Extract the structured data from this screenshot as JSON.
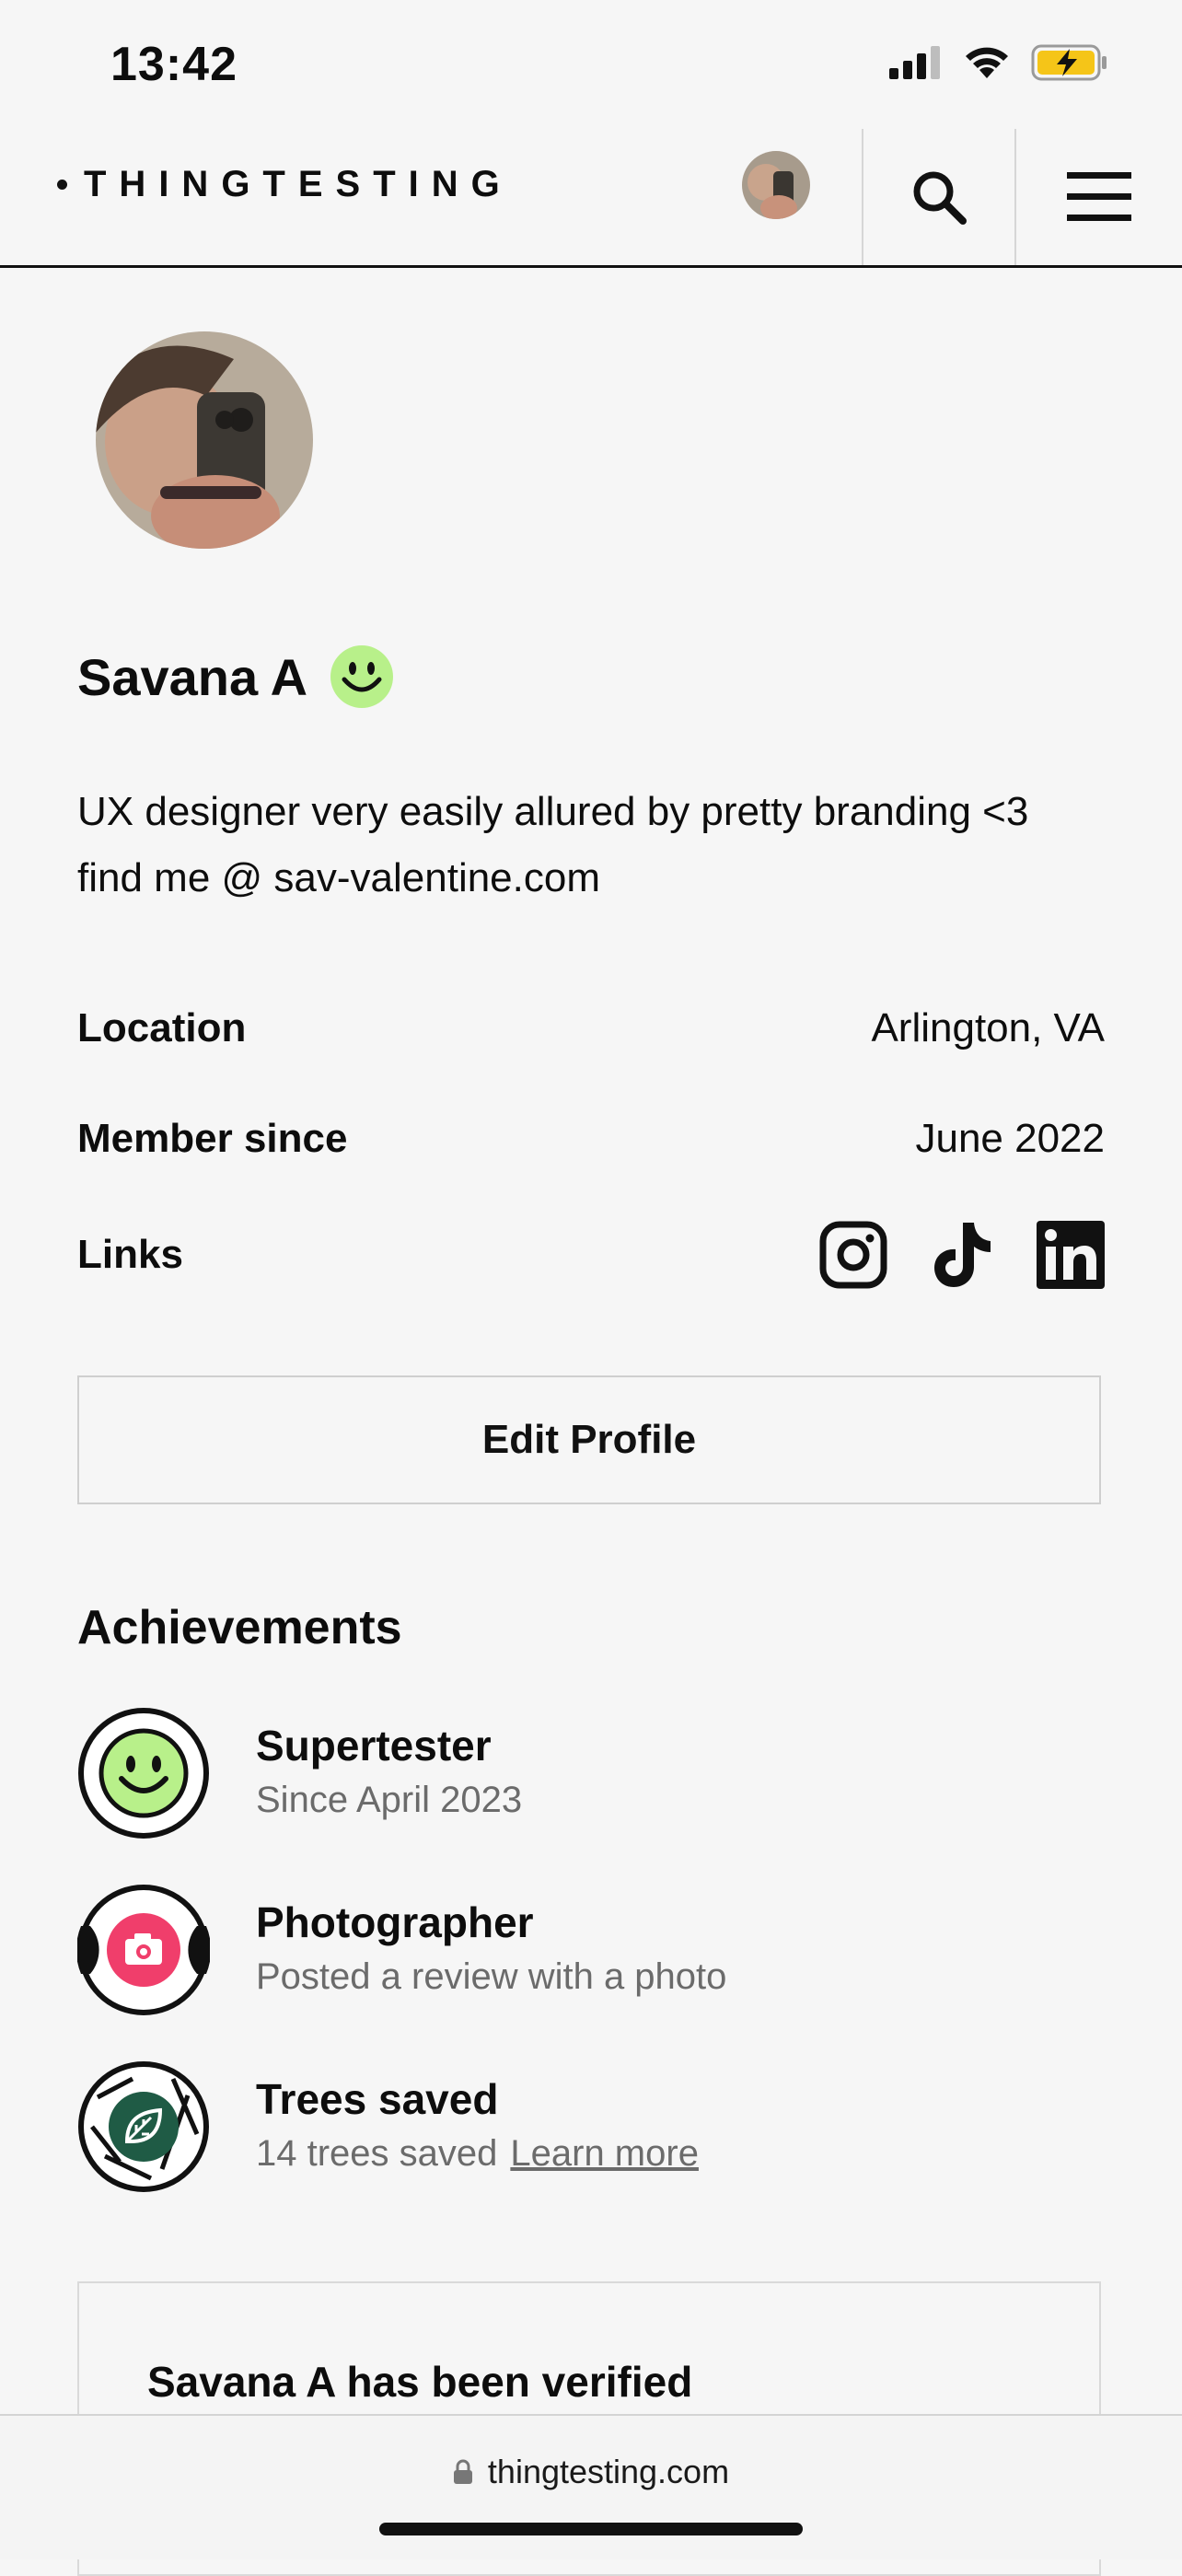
{
  "status_bar": {
    "time": "13:42"
  },
  "header": {
    "logo": "THINGTESTING"
  },
  "profile": {
    "name": "Savana A",
    "bio": [
      "UX designer very easily allured by pretty branding <3",
      "find me @ sav-valentine.com"
    ],
    "location_label": "Location",
    "location_value": "Arlington, VA",
    "member_label": "Member since",
    "member_value": "June 2022",
    "links_label": "Links",
    "links": [
      "instagram-icon",
      "tiktok-icon",
      "linkedin-icon"
    ],
    "edit_label": "Edit Profile"
  },
  "achievements": {
    "title": "Achievements",
    "items": [
      {
        "name": "Supertester",
        "sub": "Since April 2023"
      },
      {
        "name": "Photographer",
        "sub": "Posted a review with a photo"
      },
      {
        "name": "Trees saved",
        "sub": "14 trees saved",
        "link": "Learn more"
      }
    ]
  },
  "verification": {
    "title": "Savana A has been verified"
  },
  "browser": {
    "url": "thingtesting.com"
  },
  "colors": {
    "smiley_green": "#b8f08a",
    "camera_pink": "#f03e6b",
    "leaf_green": "#1f5b45"
  }
}
